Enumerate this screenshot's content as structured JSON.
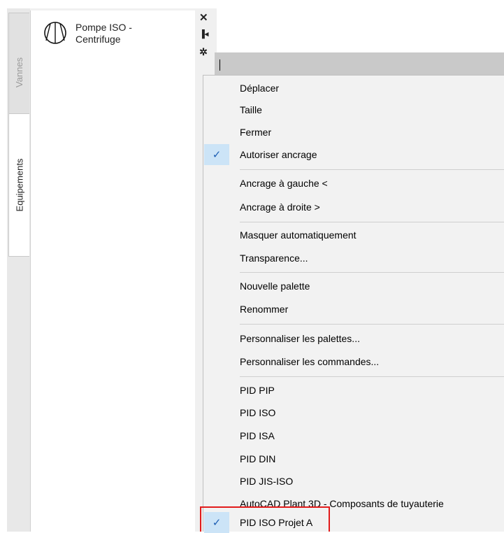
{
  "palette": {
    "tabs": [
      {
        "label": "Vannes"
      },
      {
        "label": "Equipements"
      }
    ],
    "tool": {
      "label": "Pompe ISO - Centrifuge",
      "icon": "pump-symbol-icon"
    },
    "titlebar_icons": [
      "close-icon",
      "pin-icon",
      "properties-icon"
    ]
  },
  "menu": {
    "items": [
      {
        "label": "Déplacer",
        "checked": false
      },
      {
        "label": "Taille",
        "checked": false
      },
      {
        "label": "Fermer",
        "checked": false
      },
      {
        "label": "Autoriser ancrage",
        "checked": true
      },
      {
        "label": "Ancrage à gauche  <",
        "checked": false
      },
      {
        "label": "Ancrage à droite  >",
        "checked": false
      },
      {
        "label": "Masquer automatiquement",
        "checked": false
      },
      {
        "label": "Transparence...",
        "checked": false
      },
      {
        "label": "Nouvelle palette",
        "checked": false
      },
      {
        "label": "Renommer",
        "checked": false
      },
      {
        "label": "Personnaliser les palettes...",
        "checked": false
      },
      {
        "label": "Personnaliser les commandes...",
        "checked": false
      },
      {
        "label": "PID PIP",
        "checked": false
      },
      {
        "label": "PID ISO",
        "checked": false
      },
      {
        "label": "PID ISA",
        "checked": false
      },
      {
        "label": "PID DIN",
        "checked": false
      },
      {
        "label": "PID JIS-ISO",
        "checked": false
      },
      {
        "label": "AutoCAD Plant 3D - Composants de tuyauterie",
        "checked": false
      },
      {
        "label": "PID ISO Projet A",
        "checked": true
      }
    ],
    "check_glyph": "✓",
    "highlight_color": "#e21b1b"
  }
}
